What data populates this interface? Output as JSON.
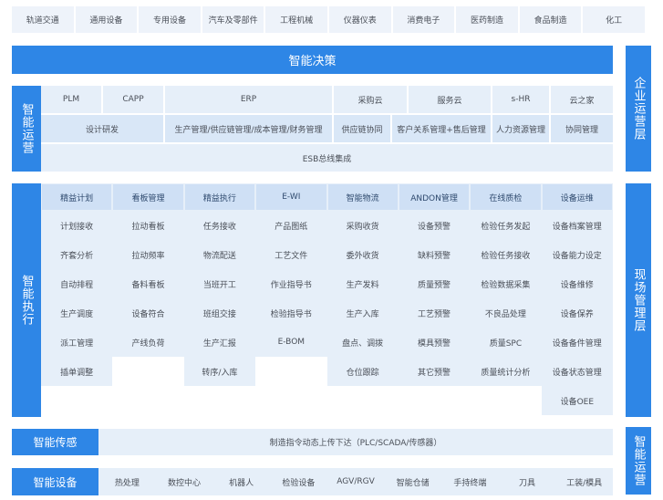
{
  "industries": [
    "轨道交通",
    "通用设备",
    "专用设备",
    "汽车及零部件",
    "工程机械",
    "仪器仪表",
    "消费电子",
    "医药制造",
    "食品制造",
    "化工"
  ],
  "decision": {
    "title": "智能决策"
  },
  "right_labels": {
    "enterprise": "企业运营层",
    "field": "现场管理层",
    "ops": "智能运营"
  },
  "operation": {
    "label": "智能运营",
    "row1": [
      "PLM",
      "CAPP",
      "ERP",
      "采购云",
      "服务云",
      "s-HR",
      "云之家"
    ],
    "row2": [
      "设计研发",
      "生产管理/供应链管理/成本管理/财务管理",
      "供应链协同",
      "客户关系管理+售后管理",
      "人力资源管理",
      "协同管理"
    ],
    "esb": "ESB总线集成"
  },
  "execution": {
    "label": "智能执行",
    "headers": [
      "精益计划",
      "看板管理",
      "精益执行",
      "E-WI",
      "智能物流",
      "ANDON管理",
      "在线质检",
      "设备运维"
    ],
    "columns": [
      [
        "计划接收",
        "齐套分析",
        "自动排程",
        "生产调度",
        "派工管理",
        "插单调整"
      ],
      [
        "拉动看板",
        "拉动频率",
        "备料看板",
        "设备符合",
        "产线负荷"
      ],
      [
        "任务接收",
        "物流配送",
        "当班开工",
        "班组交接",
        "生产汇报",
        "转序/入库"
      ],
      [
        "产品图纸",
        "工艺文件",
        "作业指导书",
        "检验指导书",
        "E-BOM"
      ],
      [
        "采购收货",
        "委外收货",
        "生产发料",
        "生产入库",
        "盘点、调拨",
        "仓位跟踪"
      ],
      [
        "设备预警",
        "缺料预警",
        "质量预警",
        "工艺预警",
        "模具预警",
        "其它预警"
      ],
      [
        "检验任务发起",
        "检验任务接收",
        "检验数据采集",
        "不良品处理",
        "质量SPC",
        "质量统计分析"
      ],
      [
        "设备档案管理",
        "设备能力设定",
        "设备维修",
        "设备保养",
        "设备备件管理",
        "设备状态管理",
        "设备OEE"
      ]
    ]
  },
  "sensing": {
    "label": "智能传感",
    "text": "制造指令动态上传下达（PLC/SCADA/传感器）"
  },
  "equipment": {
    "label": "智能设备",
    "items": [
      "热处理",
      "数控中心",
      "机器人",
      "检验设备",
      "AGV/RGV",
      "智能仓储",
      "手持终端",
      "刀具",
      "工装/模具"
    ]
  },
  "colors": {
    "primary": "#2e86e6",
    "light": "#e6eff9",
    "header": "#cfe0f5"
  }
}
